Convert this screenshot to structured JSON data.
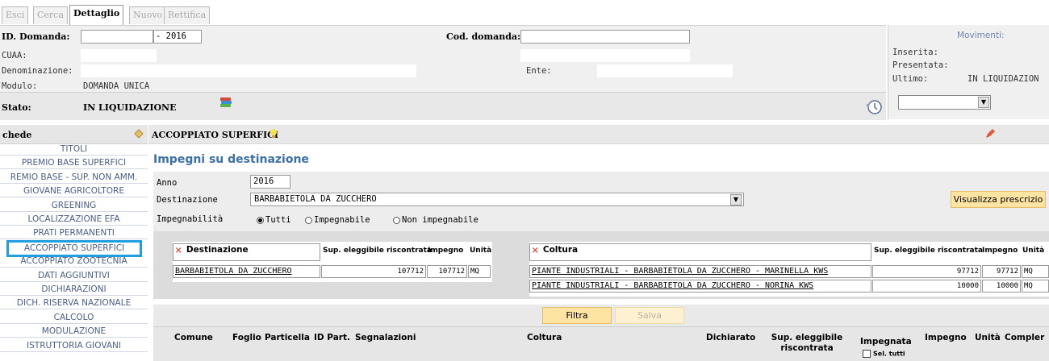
{
  "tabs": [
    "Esci",
    "Cerca",
    "Dettaglio",
    "Nuovo",
    "Rettifica"
  ],
  "header": {
    "id_domanda_label": "ID. Domanda:",
    "anno_suffix": "- 2016",
    "cod_domanda_label": "Cod. domanda:",
    "cuaa_label": "CUAA:",
    "denominazione_label": "Denominazione:",
    "ente_label": "Ente:",
    "modulo_label": "Modulo:",
    "modulo_value": "DOMANDA UNICA",
    "stato_label": "Stato:",
    "stato_value": "IN LIQUIDAZIONE"
  },
  "movimenti": {
    "title": "Movimenti:",
    "inserita_label": "Inserita:",
    "presentata_label": "Presentata:",
    "ultimo_label": "Ultimo:",
    "ultimo_value": "IN LIQUIDAZION"
  },
  "sidebar": {
    "title": "chede",
    "items": [
      "TITOLI",
      "PREMIO BASE SUPERFICI",
      "REMIO BASE - SUP. NON AMM.",
      "GIOVANE AGRICOLTORE",
      "GREENING",
      "LOCALIZZAZIONE EFA",
      "PRATI PERMANENTI",
      "ACCOPPIATO SUPERFICI",
      "ACCOPPIATO ZOOTECNIA",
      "DATI AGGIUNTIVI",
      "DICHIARAZIONI",
      "DICH. RISERVA NAZIONALE",
      "CALCOLO",
      "MODULAZIONE",
      "ISTRUTTORIA GIOVANI"
    ],
    "selected_index": 7
  },
  "content": {
    "section_title": "ACCOPPIATO SUPERFICI",
    "heading": "Impegni su destinazione",
    "anno_label": "Anno",
    "anno_value": "2016",
    "destinazione_label": "Destinazione",
    "destinazione_value": "BARBABIETOLA DA ZUCCHERO",
    "visualizza_label": "Visualizza prescrizio",
    "impegnabilita_label": "Impegnabilità",
    "radio_options": [
      "Tutti",
      "Impegnabile",
      "Non impegnabile"
    ],
    "radio_selected": 0
  },
  "dest_table": {
    "headers": [
      "Destinazione",
      "Sup. eleggibile riscontrata",
      "Impegno",
      "Unità"
    ],
    "rows": [
      [
        "BARBABIETOLA DA ZUCCHERO",
        "107712",
        "107712",
        "MQ"
      ]
    ]
  },
  "coltura_table": {
    "headers": [
      "Coltura",
      "Sup. eleggibile riscontrata",
      "Impegno",
      "Unità"
    ],
    "rows": [
      [
        "PIANTE INDUSTRIALI - BARBABIETOLA DA ZUCCHERO - MARINELLA KWS",
        "97712",
        "97712",
        "MQ"
      ],
      [
        "PIANTE INDUSTRIALI - BARBABIETOLA DA ZUCCHERO - NORINA KWS",
        "10000",
        "10000",
        "MQ"
      ]
    ]
  },
  "buttons": {
    "filtra": "Filtra",
    "salva": "Salva"
  },
  "bottom_table": {
    "headers": [
      "Comune",
      "Foglio",
      "Particella",
      "ID Part.",
      "Segnalazioni",
      "Coltura",
      "Dichiarato",
      "Sup. eleggibile riscontrata",
      "Impegnata",
      "Impegno",
      "Unità",
      "Compler"
    ],
    "sel_tutti": "Sel. tutti"
  },
  "colors": {
    "link": "#4a5f86",
    "accent_blue": "#1f9ee0",
    "button": "#fde4a3",
    "heading": "#3b6fa8"
  }
}
